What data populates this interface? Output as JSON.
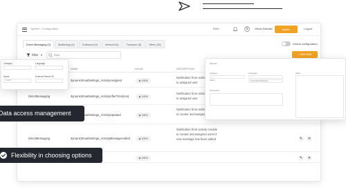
{
  "app": {
    "breadcrumb": "System / Configuration",
    "language": "ENG",
    "user_name": "Olivia Zielinski",
    "help_label": "Aptien",
    "logout_label": "Logout"
  },
  "tabs": [
    {
      "label": "Direct Messaging (3)",
      "active": true
    },
    {
      "label": "MobileApp (0)",
      "active": false
    },
    {
      "label": "Outbound (0)",
      "active": false
    },
    {
      "label": "Inbound (0)",
      "active": false
    },
    {
      "label": "Transport (0)",
      "active": false
    },
    {
      "label": "Other (15)",
      "active": false
    }
  ],
  "global_configuration": {
    "label": "Global configuration",
    "enabled": false
  },
  "toolbar": {
    "filter_label": "Filter",
    "search_placeholder": "Find",
    "add_button_label": "+ ADD NEW"
  },
  "table": {
    "columns": [
      "NAME",
      "VALUE",
      "DESCRIPTION"
    ],
    "rows": [
      {
        "type": "DirectMessaging",
        "name": "dynamicEmailSettings_ActivityAssigned",
        "value_label": "VIEW",
        "description": "Notification from activity module to assigned user"
      },
      {
        "type": "DirectMessaging",
        "name": "dynamicEmailSettings_ActivityAfterTime(min)",
        "value_label": "VIEW",
        "description": "Notification from activity module to assigned user"
      },
      {
        "type": "DirectMessaging",
        "name": "dynamicEmailSettings_ActivityUpdated",
        "value_label": "VIEW",
        "description": "Notification from activity module to creator and assigned user"
      },
      {
        "type": "DirectMessaging",
        "name": "dynamicEmailSettings_ActivityMessageAdded",
        "value_label": "VIEW",
        "description": "Notification from activity module to creator and assigned users if new message has been added"
      },
      {
        "type": "",
        "name": "ntModified",
        "value_label": "VIEW",
        "description": ""
      }
    ],
    "edit_icon": "pencil-icon",
    "delete_icon": "close-icon"
  },
  "filter_panel": {
    "category_label": "Category",
    "language_label": "Language",
    "name_label": "Name",
    "external_record_label": "External Record ID",
    "name_value": "System"
  },
  "form_panel": {
    "title": "Edit item",
    "category_label": "Category",
    "language_label": "Language",
    "value_label": "Value",
    "name_label": "Name",
    "description_label": "Description",
    "category_value": "—",
    "name_value": "dynamicEmailSettings",
    "language_value": "—"
  },
  "badges": {
    "data_access": "Data access management",
    "flexibility": "Flexibility in choosing options"
  },
  "colors": {
    "accent": "#f0a224",
    "badge_bg": "#24272e"
  }
}
